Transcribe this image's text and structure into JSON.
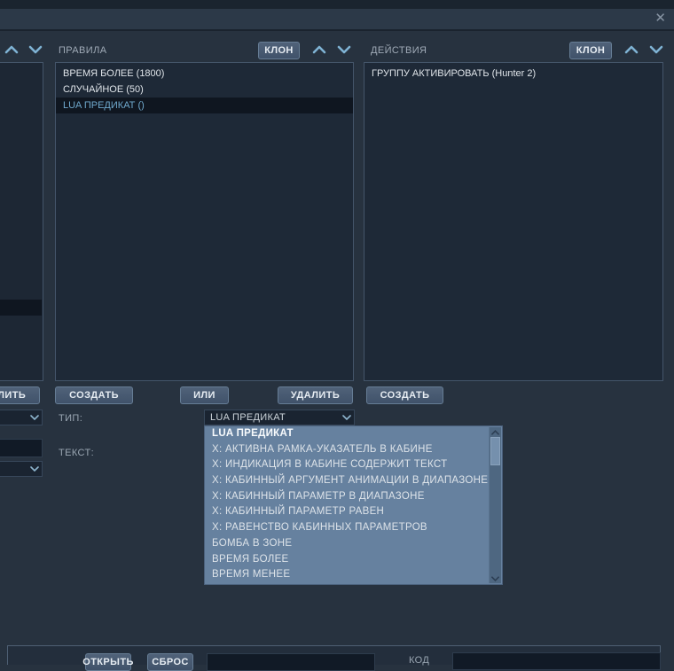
{
  "icons": {
    "close": "✕"
  },
  "rules_section": {
    "title": "ПРАВИЛА",
    "clone_label": "КЛОН",
    "items": [
      {
        "label": "ВРЕМЯ БОЛЕЕ (1800)",
        "selected": false
      },
      {
        "label": "СЛУЧАЙНОЕ (50)",
        "selected": false
      },
      {
        "label": "LUA ПРЕДИКАТ ()",
        "selected": true
      }
    ]
  },
  "actions_section": {
    "title": "ДЕЙСТВИЯ",
    "clone_label": "КЛОН",
    "items": [
      {
        "label": "ГРУППУ АКТИВИРОВАТЬ (Hunter 2)"
      }
    ]
  },
  "buttons": {
    "delete_left_partial": "УДАЛИТЬ",
    "create_rule": "СОЗДАТЬ",
    "or": "ИЛИ",
    "delete_action": "УДАЛИТЬ",
    "create_action": "СОЗДАТЬ",
    "open": "ОТКРЫТЬ",
    "reset": "СБРОС"
  },
  "fields": {
    "type_label": "ТИП:",
    "type_value": "LUA ПРЕДИКАТ",
    "text_label": "ТЕКСТ:",
    "code_label": "КОД"
  },
  "type_dropdown": {
    "options": [
      {
        "label": "LUA ПРЕДИКАТ",
        "selected": true
      },
      {
        "label": "X: АКТИВНА РАМКА-УКАЗАТЕЛЬ В КАБИНЕ",
        "selected": false
      },
      {
        "label": "X: ИНДИКАЦИЯ В КАБИНЕ СОДЕРЖИТ ТЕКСТ",
        "selected": false
      },
      {
        "label": "X: КАБИННЫЙ АРГУМЕНТ АНИМАЦИИ В ДИАПАЗОНЕ",
        "selected": false
      },
      {
        "label": "X: КАБИННЫЙ ПАРАМЕТР В ДИАПАЗОНЕ",
        "selected": false
      },
      {
        "label": "X: КАБИННЫЙ ПАРАМЕТР РАВЕН",
        "selected": false
      },
      {
        "label": "X: РАВЕНСТВО КАБИННЫХ ПАРАМЕТРОВ",
        "selected": false
      },
      {
        "label": "БОМБА В ЗОНЕ",
        "selected": false
      },
      {
        "label": "ВРЕМЯ БОЛЕЕ",
        "selected": false
      },
      {
        "label": "ВРЕМЯ МЕНЕЕ",
        "selected": false
      }
    ]
  },
  "colors": {
    "accent_chevron": "#7fb3d4",
    "selected_item_text": "#6fa9cd",
    "selected_item_bg": "#0f1620",
    "dropdown_open_bg": "#66819f",
    "panel_bg": "#1e2937",
    "header_bg": "#2c3948",
    "button_border": "#667d95"
  }
}
